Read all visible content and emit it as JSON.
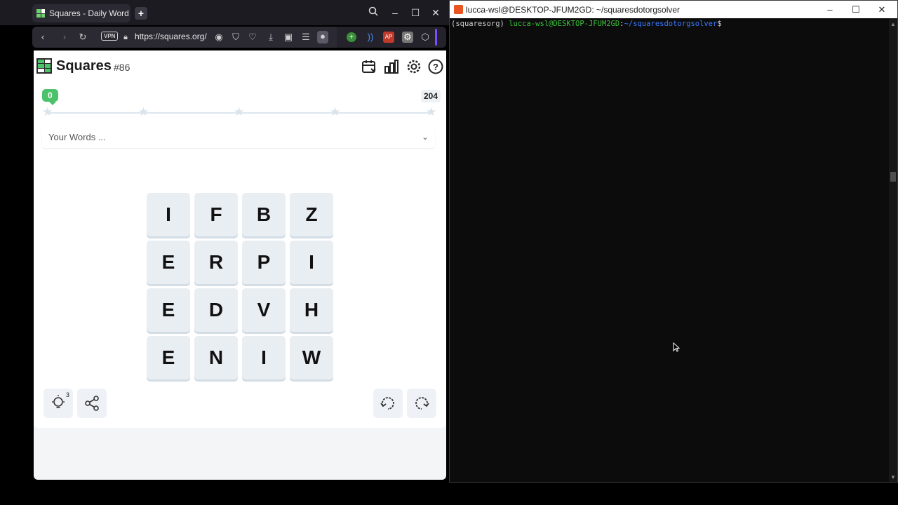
{
  "browser": {
    "tab_title": "Squares - Daily Word Gam",
    "new_tab": "+",
    "url": "https://squares.org/",
    "vpn_label": "VPN",
    "win_minimize": "–",
    "win_maximize": "☐",
    "win_close": "✕"
  },
  "game": {
    "brand": "Squares",
    "puzzle_number": "#86",
    "score": "0",
    "max_score": "204",
    "words_label": "Your Words ...",
    "hints_count": "3",
    "board": [
      [
        "I",
        "F",
        "B",
        "Z"
      ],
      [
        "E",
        "R",
        "P",
        "I"
      ],
      [
        "E",
        "D",
        "V",
        "H"
      ],
      [
        "E",
        "N",
        "I",
        "W"
      ]
    ],
    "colors": {
      "accent": "#4cc26a",
      "tile": "#e9eef3"
    }
  },
  "terminal": {
    "title": "lucca-wsl@DESKTOP-JFUM2GD: ~/squaresdotorgsolver",
    "prompt_env": "(squaresorg) ",
    "prompt_user": "lucca-wsl@DESKTOP-JFUM2GD",
    "prompt_sep": ":",
    "prompt_path": "~/squaresdotorgsolver",
    "prompt_end": "$"
  }
}
